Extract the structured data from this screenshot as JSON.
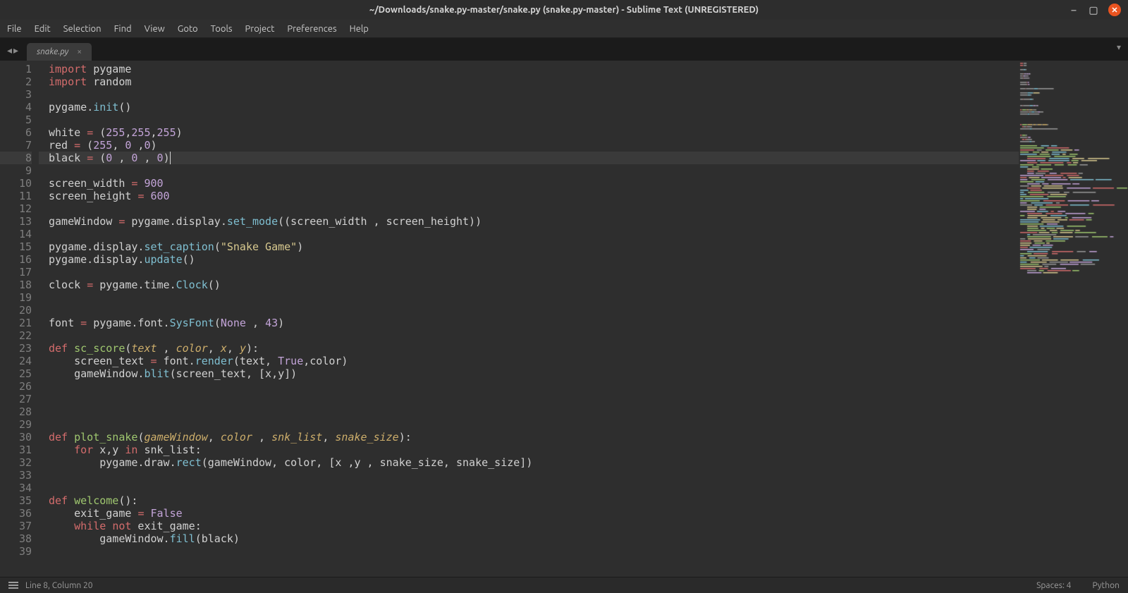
{
  "titlebar": {
    "title": "~/Downloads/snake.py-master/snake.py (snake.py-master) - Sublime Text (UNREGISTERED)"
  },
  "menubar": {
    "items": [
      "File",
      "Edit",
      "Selection",
      "Find",
      "View",
      "Goto",
      "Tools",
      "Project",
      "Preferences",
      "Help"
    ]
  },
  "tabs": {
    "active": {
      "label": "snake.py",
      "close": "×"
    },
    "nav_prev": "◂",
    "nav_next": "▸",
    "more": "▾"
  },
  "statusbar": {
    "left": "Line 8, Column 20",
    "spaces": "Spaces: 4",
    "lang": "Python"
  },
  "editor": {
    "highlighted_line": 8,
    "line_count": 39,
    "lines": [
      {
        "n": 1,
        "t": [
          [
            "import",
            "kw"
          ],
          [
            " ",
            ""
          ],
          [
            "pygame",
            "name"
          ]
        ]
      },
      {
        "n": 2,
        "t": [
          [
            "import",
            "kw"
          ],
          [
            " ",
            ""
          ],
          [
            "random",
            "name"
          ]
        ]
      },
      {
        "n": 3,
        "t": []
      },
      {
        "n": 4,
        "t": [
          [
            "pygame",
            "name"
          ],
          [
            ".",
            ""
          ],
          [
            "init",
            "func"
          ],
          [
            "()",
            ""
          ]
        ]
      },
      {
        "n": 5,
        "t": []
      },
      {
        "n": 6,
        "t": [
          [
            "white ",
            "name"
          ],
          [
            "=",
            "op"
          ],
          [
            " (",
            ""
          ],
          [
            "255",
            "num"
          ],
          [
            ",",
            ""
          ],
          [
            "255",
            "num"
          ],
          [
            ",",
            ""
          ],
          [
            "255",
            "num"
          ],
          [
            ")",
            ""
          ]
        ]
      },
      {
        "n": 7,
        "t": [
          [
            "red ",
            "name"
          ],
          [
            "=",
            "op"
          ],
          [
            " (",
            ""
          ],
          [
            "255",
            "num"
          ],
          [
            ", ",
            ""
          ],
          [
            "0",
            "num"
          ],
          [
            " ,",
            ""
          ],
          [
            "0",
            "num"
          ],
          [
            ")",
            ""
          ]
        ]
      },
      {
        "n": 8,
        "t": [
          [
            "black ",
            "name"
          ],
          [
            "=",
            "op"
          ],
          [
            " (",
            ""
          ],
          [
            "0",
            "num"
          ],
          [
            " , ",
            ""
          ],
          [
            "0",
            "num"
          ],
          [
            " , ",
            ""
          ],
          [
            "0",
            "num"
          ],
          [
            ")",
            ""
          ]
        ],
        "caret": true
      },
      {
        "n": 9,
        "t": []
      },
      {
        "n": 10,
        "t": [
          [
            "screen_width ",
            "name"
          ],
          [
            "=",
            "op"
          ],
          [
            " ",
            ""
          ],
          [
            "900",
            "num"
          ]
        ]
      },
      {
        "n": 11,
        "t": [
          [
            "screen_height ",
            "name"
          ],
          [
            "=",
            "op"
          ],
          [
            " ",
            ""
          ],
          [
            "600",
            "num"
          ]
        ]
      },
      {
        "n": 12,
        "t": []
      },
      {
        "n": 13,
        "t": [
          [
            "gameWindow ",
            "name"
          ],
          [
            "=",
            "op"
          ],
          [
            " pygame.display.",
            ""
          ],
          [
            "set_mode",
            "func"
          ],
          [
            "((screen_width , screen_height))",
            ""
          ]
        ]
      },
      {
        "n": 14,
        "t": []
      },
      {
        "n": 15,
        "t": [
          [
            "pygame.display.",
            ""
          ],
          [
            "set_caption",
            "func"
          ],
          [
            "(",
            ""
          ],
          [
            "\"Snake Game\"",
            "str"
          ],
          [
            ")",
            ""
          ]
        ]
      },
      {
        "n": 16,
        "t": [
          [
            "pygame.display.",
            ""
          ],
          [
            "update",
            "func"
          ],
          [
            "()",
            ""
          ]
        ]
      },
      {
        "n": 17,
        "t": []
      },
      {
        "n": 18,
        "t": [
          [
            "clock ",
            "name"
          ],
          [
            "=",
            "op"
          ],
          [
            " pygame.time.",
            ""
          ],
          [
            "Clock",
            "func"
          ],
          [
            "()",
            ""
          ]
        ]
      },
      {
        "n": 19,
        "t": []
      },
      {
        "n": 20,
        "t": []
      },
      {
        "n": 21,
        "t": [
          [
            "font ",
            "name"
          ],
          [
            "=",
            "op"
          ],
          [
            " pygame.font.",
            ""
          ],
          [
            "SysFont",
            "func"
          ],
          [
            "(",
            ""
          ],
          [
            "None",
            "const"
          ],
          [
            " , ",
            ""
          ],
          [
            "43",
            "num"
          ],
          [
            ")",
            ""
          ]
        ]
      },
      {
        "n": 22,
        "t": []
      },
      {
        "n": 23,
        "t": [
          [
            "def",
            "kw"
          ],
          [
            " ",
            ""
          ],
          [
            "sc_score",
            "funcdef"
          ],
          [
            "(",
            ""
          ],
          [
            "text",
            "param"
          ],
          [
            " , ",
            ""
          ],
          [
            "color",
            "param"
          ],
          [
            ", ",
            ""
          ],
          [
            "x",
            "param"
          ],
          [
            ", ",
            ""
          ],
          [
            "y",
            "param"
          ],
          [
            "):",
            ""
          ]
        ]
      },
      {
        "n": 24,
        "t": [
          [
            "    screen_text ",
            "name"
          ],
          [
            "=",
            "op"
          ],
          [
            " font.",
            ""
          ],
          [
            "render",
            "func"
          ],
          [
            "(text, ",
            ""
          ],
          [
            "True",
            "const"
          ],
          [
            ",color)",
            ""
          ]
        ]
      },
      {
        "n": 25,
        "t": [
          [
            "    gameWindow.",
            ""
          ],
          [
            "blit",
            "func"
          ],
          [
            "(screen_text, [x,y])",
            ""
          ]
        ]
      },
      {
        "n": 26,
        "t": []
      },
      {
        "n": 27,
        "t": []
      },
      {
        "n": 28,
        "t": []
      },
      {
        "n": 29,
        "t": []
      },
      {
        "n": 30,
        "t": [
          [
            "def",
            "kw"
          ],
          [
            " ",
            ""
          ],
          [
            "plot_snake",
            "funcdef"
          ],
          [
            "(",
            ""
          ],
          [
            "gameWindow",
            "param"
          ],
          [
            ", ",
            ""
          ],
          [
            "color",
            "param"
          ],
          [
            " , ",
            ""
          ],
          [
            "snk_list",
            "param"
          ],
          [
            ", ",
            ""
          ],
          [
            "snake_size",
            "param"
          ],
          [
            "):",
            ""
          ]
        ]
      },
      {
        "n": 31,
        "t": [
          [
            "    ",
            ""
          ],
          [
            "for",
            "kw"
          ],
          [
            " x,y ",
            ""
          ],
          [
            "in",
            "kw"
          ],
          [
            " snk_list:",
            ""
          ]
        ]
      },
      {
        "n": 32,
        "t": [
          [
            "        pygame.draw.",
            ""
          ],
          [
            "rect",
            "func"
          ],
          [
            "(gameWindow, color, [x ,y , snake_size, snake_size])",
            ""
          ]
        ]
      },
      {
        "n": 33,
        "t": []
      },
      {
        "n": 34,
        "t": []
      },
      {
        "n": 35,
        "t": [
          [
            "def",
            "kw"
          ],
          [
            " ",
            ""
          ],
          [
            "welcome",
            "funcdef"
          ],
          [
            "():",
            ""
          ]
        ]
      },
      {
        "n": 36,
        "t": [
          [
            "    exit_game ",
            "name"
          ],
          [
            "=",
            "op"
          ],
          [
            " ",
            ""
          ],
          [
            "False",
            "const"
          ]
        ]
      },
      {
        "n": 37,
        "t": [
          [
            "    ",
            ""
          ],
          [
            "while",
            "kw"
          ],
          [
            " ",
            ""
          ],
          [
            "not",
            "kw"
          ],
          [
            " exit_game:",
            ""
          ]
        ]
      },
      {
        "n": 38,
        "t": [
          [
            "        gameWindow.",
            ""
          ],
          [
            "fill",
            "func"
          ],
          [
            "(black)",
            ""
          ]
        ]
      },
      {
        "n": 39,
        "t": []
      }
    ]
  }
}
